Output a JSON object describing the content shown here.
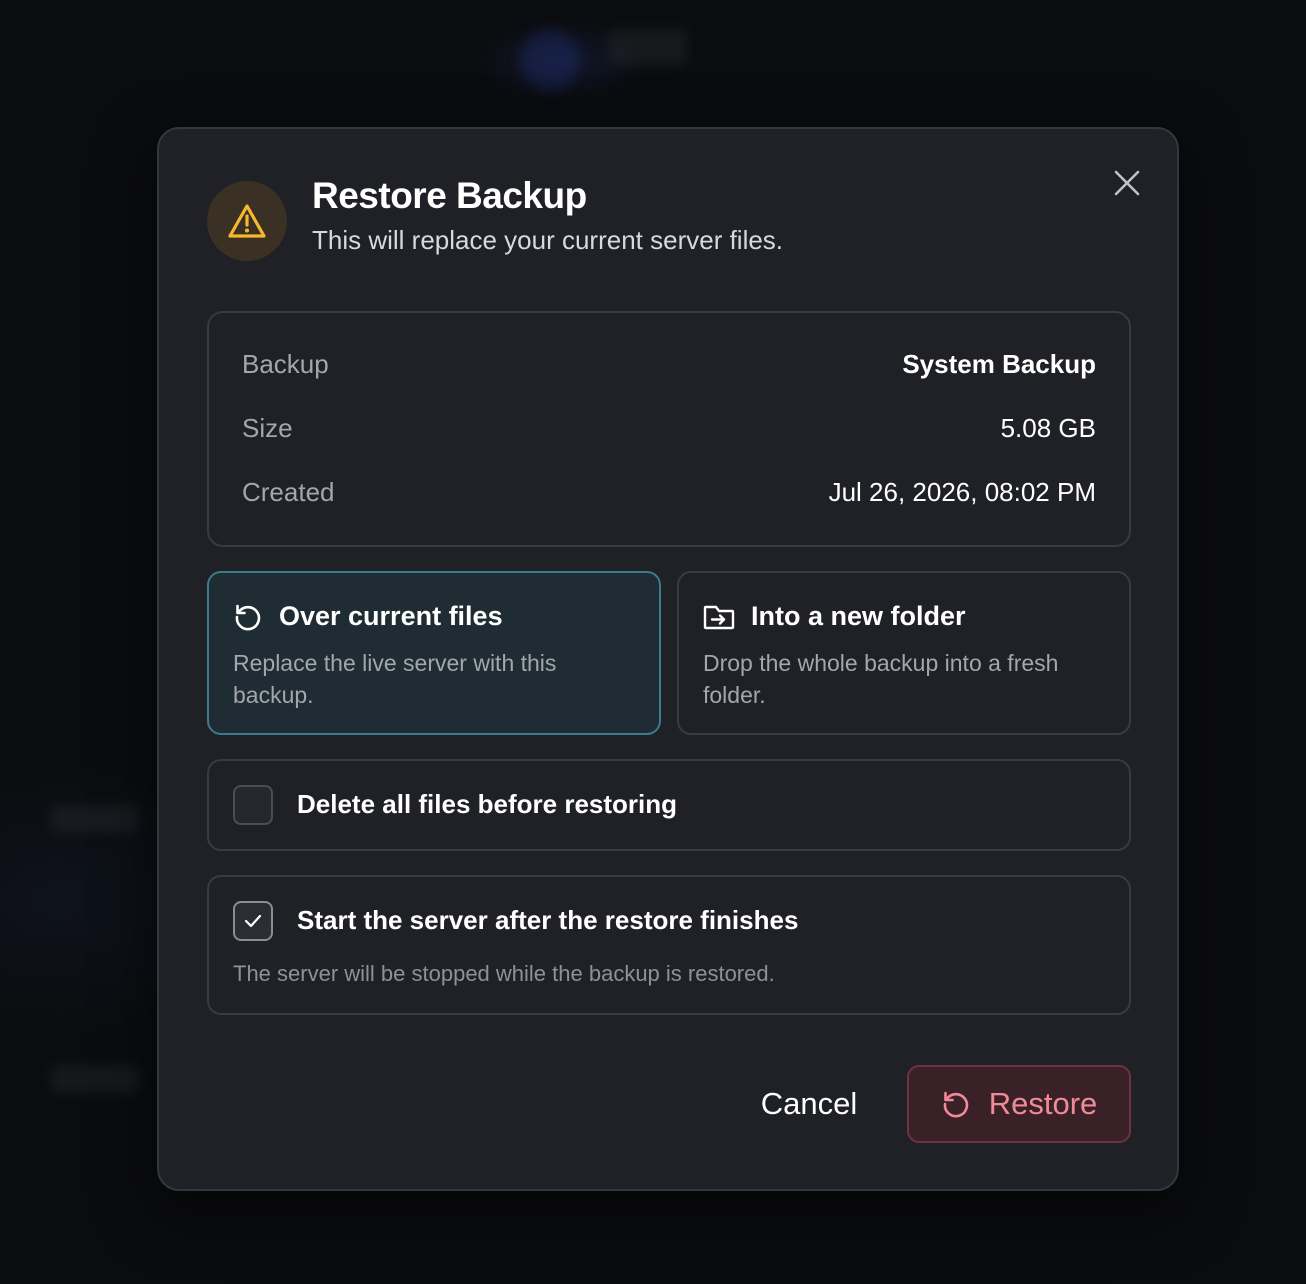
{
  "dialog": {
    "title": "Restore Backup",
    "subtitle": "This will replace your current server files.",
    "icon": "warning-icon",
    "close_icon": "close-icon"
  },
  "details": [
    {
      "label": "Backup",
      "value": "System Backup"
    },
    {
      "label": "Size",
      "value": "5.08 GB"
    },
    {
      "label": "Created",
      "value": "Jul 26, 2026, 08:02 PM"
    }
  ],
  "options": [
    {
      "title": "Over current files",
      "description": "Replace the live server with this backup.",
      "icon": "restore-icon",
      "selected": true
    },
    {
      "title": "Into a new folder",
      "description": "Drop the whole backup into a fresh folder.",
      "icon": "folder-import-icon",
      "selected": false
    }
  ],
  "checks": {
    "delete_all": {
      "label": "Delete all files before restoring",
      "checked": false
    },
    "start_after": {
      "label": "Start the server after the restore finishes",
      "checked": true,
      "note": "The server will be stopped while the backup is restored."
    }
  },
  "actions": {
    "cancel_label": "Cancel",
    "restore_label": "Restore"
  },
  "colors": {
    "accent_selected_border": "#3b7c8c",
    "warning": "#f5b82e",
    "danger_text": "#f08a98",
    "danger_bg": "#3a2127"
  }
}
